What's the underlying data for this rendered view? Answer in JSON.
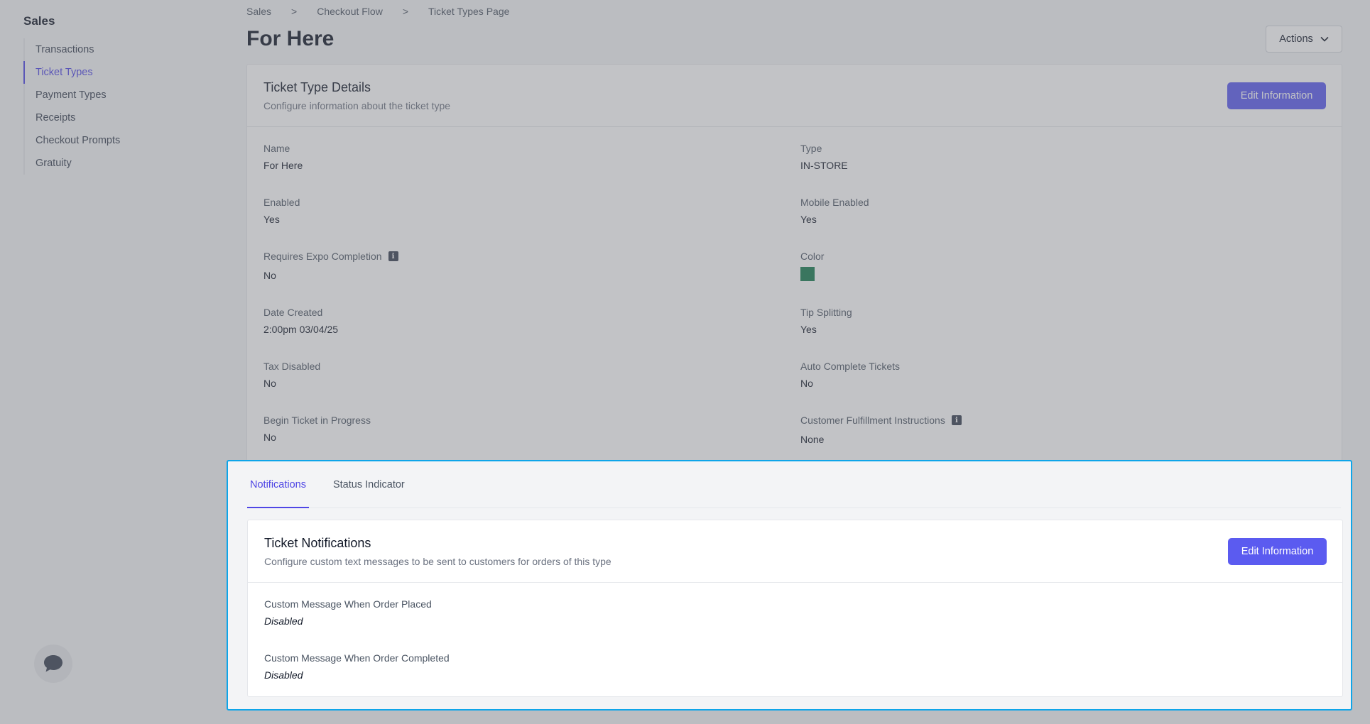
{
  "sidebar": {
    "title": "Sales",
    "items": [
      {
        "label": "Transactions",
        "active": false
      },
      {
        "label": "Ticket Types",
        "active": true
      },
      {
        "label": "Payment Types",
        "active": false
      },
      {
        "label": "Receipts",
        "active": false
      },
      {
        "label": "Checkout Prompts",
        "active": false
      },
      {
        "label": "Gratuity",
        "active": false
      }
    ]
  },
  "breadcrumb": [
    "Sales",
    ">",
    "Checkout Flow",
    ">",
    "Ticket Types Page"
  ],
  "page": {
    "title": "For Here",
    "actions_label": "Actions"
  },
  "details_card": {
    "title": "Ticket Type Details",
    "subtitle": "Configure information about the ticket type",
    "edit_label": "Edit Information",
    "fields": {
      "name": {
        "label": "Name",
        "value": "For Here"
      },
      "type": {
        "label": "Type",
        "value": "IN-STORE"
      },
      "enabled": {
        "label": "Enabled",
        "value": "Yes"
      },
      "mobile_enabled": {
        "label": "Mobile Enabled",
        "value": "Yes"
      },
      "requires_expo": {
        "label": "Requires Expo Completion",
        "value": "No"
      },
      "color": {
        "label": "Color",
        "value": "#157a4f"
      },
      "date_created": {
        "label": "Date Created",
        "value": "2:00pm 03/04/25"
      },
      "tip_splitting": {
        "label": "Tip Splitting",
        "value": "Yes"
      },
      "tax_disabled": {
        "label": "Tax Disabled",
        "value": "No"
      },
      "auto_complete": {
        "label": "Auto Complete Tickets",
        "value": "No"
      },
      "begin_in_progress": {
        "label": "Begin Ticket in Progress",
        "value": "No"
      },
      "fulfillment": {
        "label": "Customer Fulfillment Instructions",
        "value": "None"
      }
    }
  },
  "tabs": [
    {
      "label": "Notifications",
      "active": true
    },
    {
      "label": "Status Indicator",
      "active": false
    }
  ],
  "notifications_card": {
    "title": "Ticket Notifications",
    "subtitle": "Configure custom text messages to be sent to customers for orders of this type",
    "edit_label": "Edit Information",
    "fields": {
      "order_placed": {
        "label": "Custom Message When Order Placed",
        "value": "Disabled"
      },
      "order_completed": {
        "label": "Custom Message When Order Completed",
        "value": "Disabled"
      }
    }
  },
  "colors": {
    "accent": "#5b5bf0",
    "highlight_border": "#0ea5e9"
  }
}
